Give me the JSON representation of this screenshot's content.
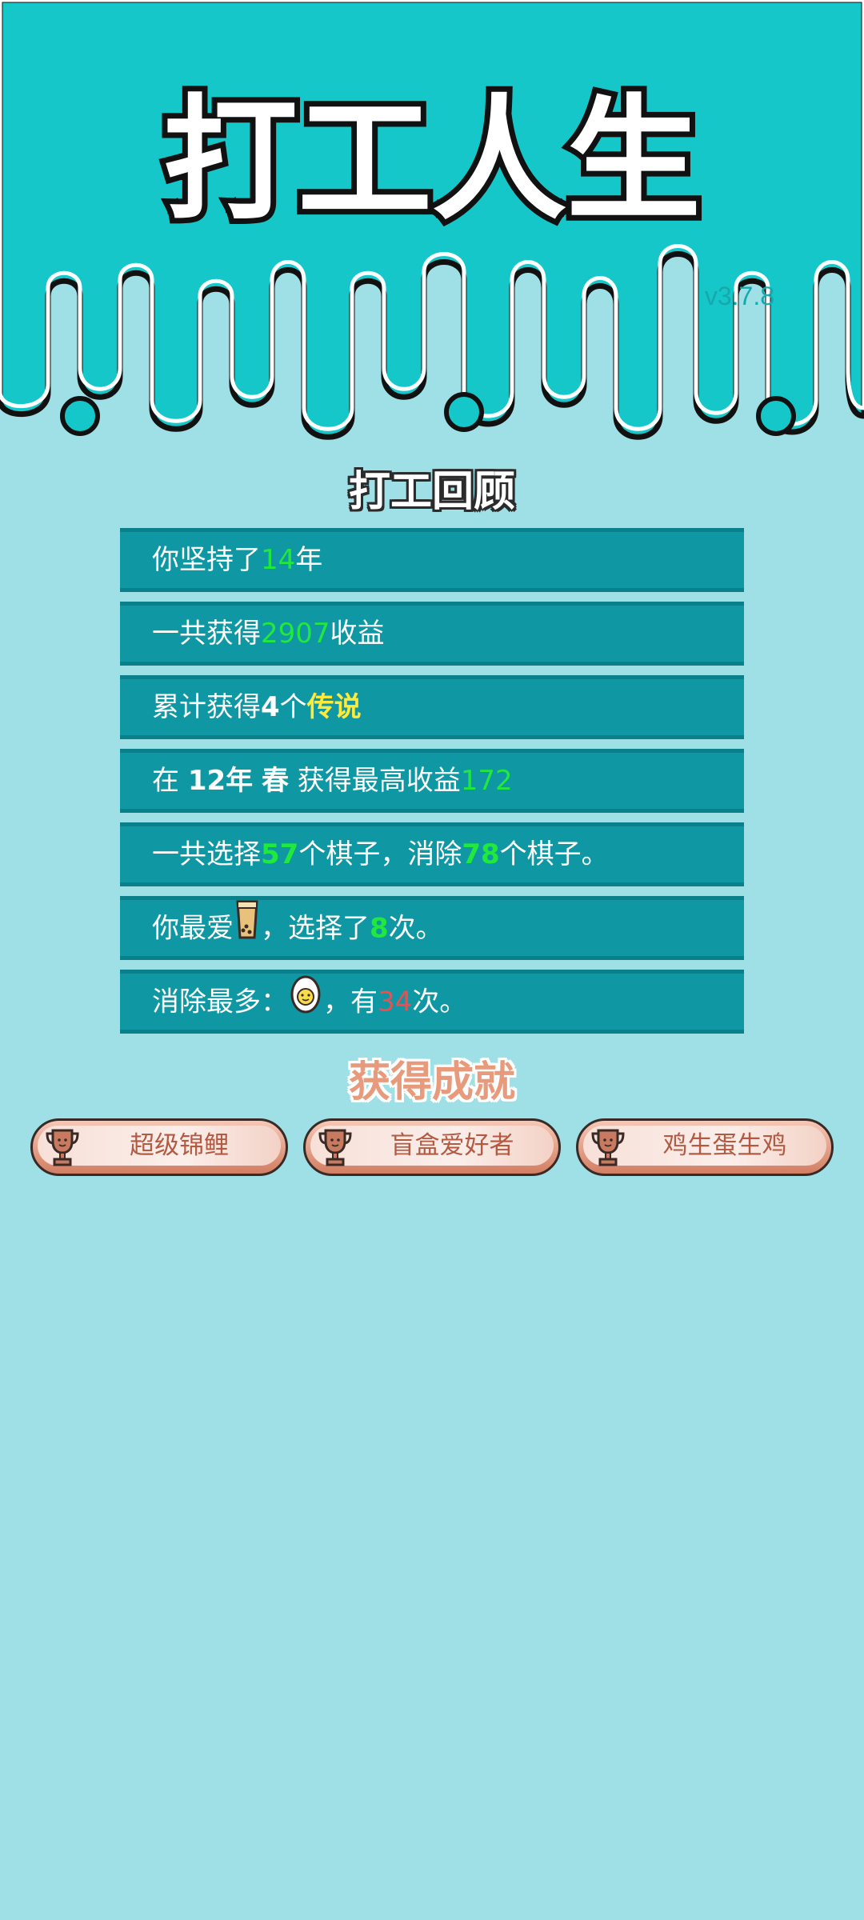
{
  "game": {
    "title": "打工人生",
    "version": "v3.7.8"
  },
  "colors": {
    "header_bg": "#15c7c9",
    "page_bg": "#9fdfe6",
    "row_bg": "#0f98a3",
    "highlight_green": "#21e83c",
    "highlight_yellow": "#ffe93b",
    "highlight_red": "#ef4e4e",
    "achievement_text": "#b35a43"
  },
  "review": {
    "title": "打工回顾",
    "rows": [
      {
        "pre": "你坚持了",
        "value": "14",
        "post": "年"
      },
      {
        "pre": "一共获得",
        "value": "2907",
        "post": "收益"
      },
      {
        "pre": "累计获得",
        "value": "4",
        "mid": "个",
        "value2": "传说"
      },
      {
        "pre": "在 ",
        "year": "12年",
        "season": "春",
        "mid": " 获得最高收益",
        "value": "172"
      },
      {
        "pre": "一共选择",
        "value": "57",
        "mid": "个棋子，消除",
        "value2": "78",
        "post": "个棋子。"
      },
      {
        "pre": "你最爱",
        "icon": "bubble-tea-icon",
        "mid": "，选择了",
        "value": "8",
        "post": "次。"
      },
      {
        "pre": "消除最多：",
        "icon": "egg-icon",
        "mid": "，有",
        "value": "34",
        "post": "次。"
      }
    ]
  },
  "achievements": {
    "title": "获得成就",
    "icon": "trophy-icon",
    "items": [
      {
        "label": "超级锦鲤"
      },
      {
        "label": "盲盒爱好者"
      },
      {
        "label": "鸡生蛋生鸡"
      }
    ]
  }
}
